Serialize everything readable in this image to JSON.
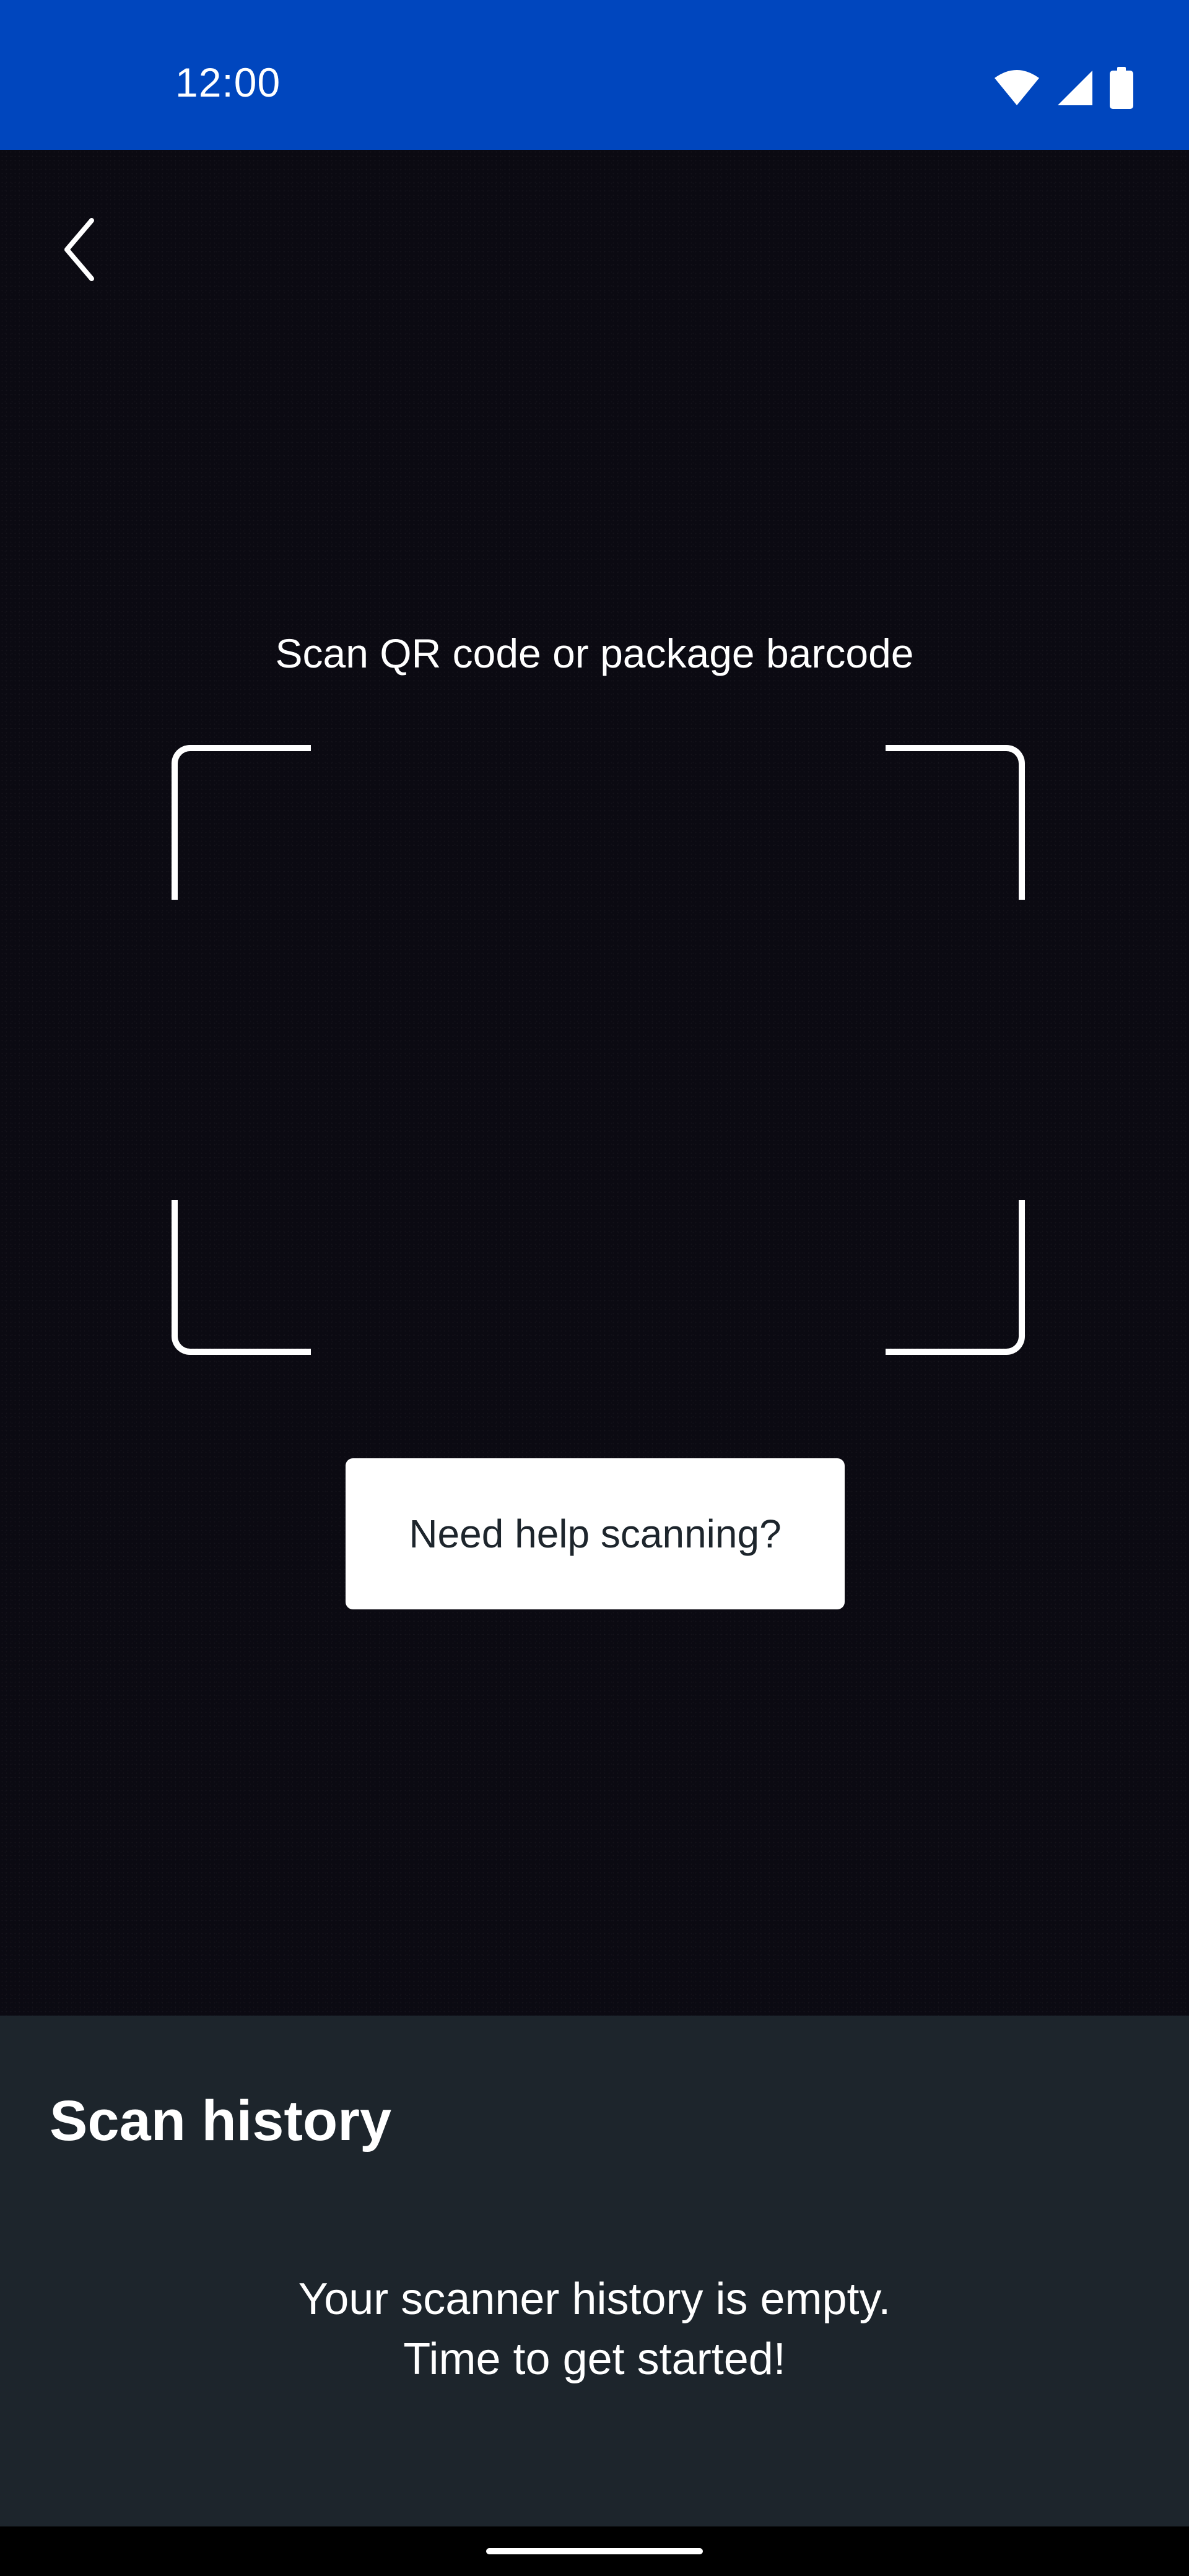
{
  "status_bar": {
    "time": "12:00",
    "icons": [
      "wifi-icon",
      "signal-icon",
      "battery-icon"
    ],
    "background_color": "#0046BE"
  },
  "navigation": {
    "back_icon": "chevron-left-icon"
  },
  "scanner": {
    "instruction": "Scan QR code or package barcode",
    "help_button_label": "Need help scanning?"
  },
  "history": {
    "title": "Scan history",
    "empty_line1": "Your scanner history is empty.",
    "empty_line2": "Time to get started!"
  },
  "colors": {
    "panel": "#1d252c",
    "camera": "#0b0a12",
    "frame": "#ffffff"
  }
}
